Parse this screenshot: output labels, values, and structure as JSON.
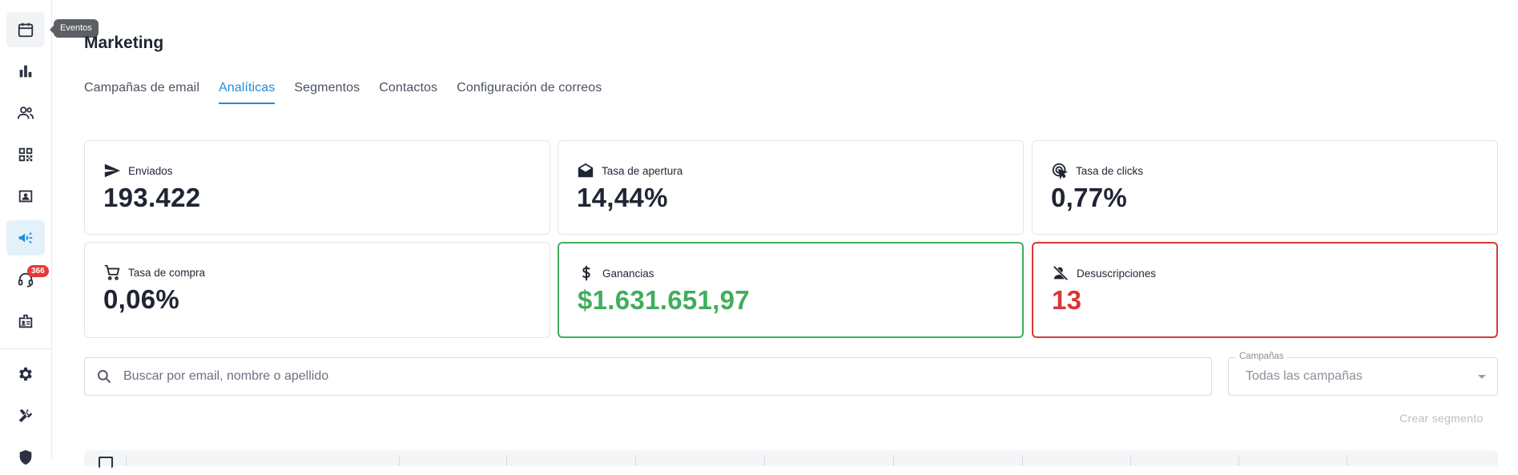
{
  "sidebar": {
    "tooltip": "Eventos",
    "badge_count": "366",
    "items": [
      {
        "icon": "calendar-icon",
        "label": "Eventos"
      },
      {
        "icon": "bar-chart-icon"
      },
      {
        "icon": "people-icon"
      },
      {
        "icon": "qr-code-icon"
      },
      {
        "icon": "contact-card-icon"
      },
      {
        "icon": "megaphone-icon",
        "active": true
      },
      {
        "icon": "support-agent-icon"
      },
      {
        "icon": "badge-icon"
      },
      {
        "icon": "settings-gear-icon"
      },
      {
        "icon": "tools-icon"
      },
      {
        "icon": "security-shield-icon"
      }
    ],
    "accent_color": "#1e8fd6"
  },
  "page": {
    "title": "Marketing"
  },
  "tabs": [
    {
      "label": "Campañas de email",
      "active": false
    },
    {
      "label": "Analíticas",
      "active": true
    },
    {
      "label": "Segmentos",
      "active": false
    },
    {
      "label": "Contactos",
      "active": false
    },
    {
      "label": "Configuración de correos",
      "active": false
    }
  ],
  "metrics": {
    "sent": {
      "label": "Enviados",
      "value": "193.422",
      "icon": "send-icon"
    },
    "open_rate": {
      "label": "Tasa de apertura",
      "value": "14,44%",
      "icon": "open-mail-icon"
    },
    "click_rate": {
      "label": "Tasa de clicks",
      "value": "0,77%",
      "icon": "click-icon"
    },
    "purchase_rate": {
      "label": "Tasa de compra",
      "value": "0,06%",
      "icon": "cart-icon"
    },
    "earnings": {
      "label": "Ganancias",
      "value": "$1.631.651,97",
      "icon": "dollar-icon",
      "color": "#3fae5c"
    },
    "unsubscribes": {
      "label": "Desuscripciones",
      "value": "13",
      "icon": "person-off-icon",
      "color": "#d93636"
    }
  },
  "search": {
    "placeholder": "Buscar por email, nombre o apellido",
    "value": ""
  },
  "campaign_filter": {
    "label": "Campañas",
    "selected": "Todas las campañas"
  },
  "actions": {
    "create_segment": "Crear segmento"
  }
}
